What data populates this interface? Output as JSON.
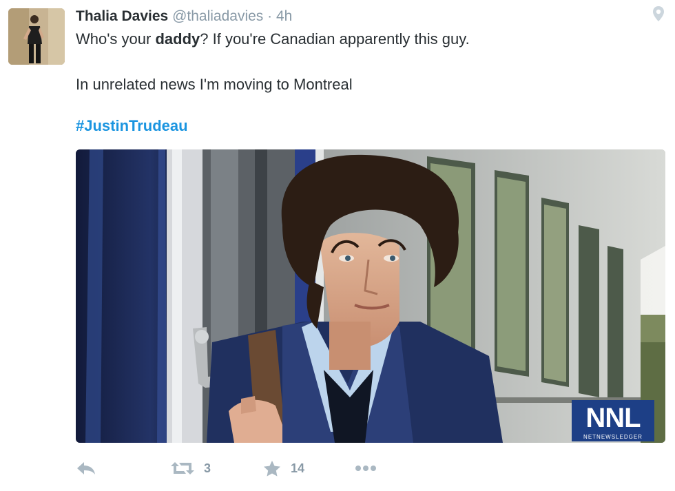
{
  "tweet": {
    "author": {
      "fullname": "Thalia Davies",
      "username": "@thaliadavies",
      "separator": "·",
      "timestamp": "4h"
    },
    "text_line1": {
      "pre": "Who's your ",
      "bold": "daddy",
      "post": "? If you're Canadian apparently this guy."
    },
    "text_line2": "In unrelated news I'm moving to Montreal",
    "hashtag": "#JustinTrudeau",
    "media": {
      "watermark_main": "NNL",
      "watermark_sub": "NETNEWSLEDGER"
    },
    "actions": {
      "reply_icon": "reply-icon",
      "retweet_icon": "retweet-icon",
      "retweet_count": "3",
      "favorite_icon": "star-icon",
      "favorite_count": "14",
      "more_icon": "more-dots-icon"
    },
    "geo_icon": "location-pin-icon"
  },
  "colors": {
    "text": "#292f33",
    "muted": "#8899a6",
    "link": "#1b95e0",
    "icon": "#aab8c2",
    "watermark_bg": "#1d3f86"
  }
}
